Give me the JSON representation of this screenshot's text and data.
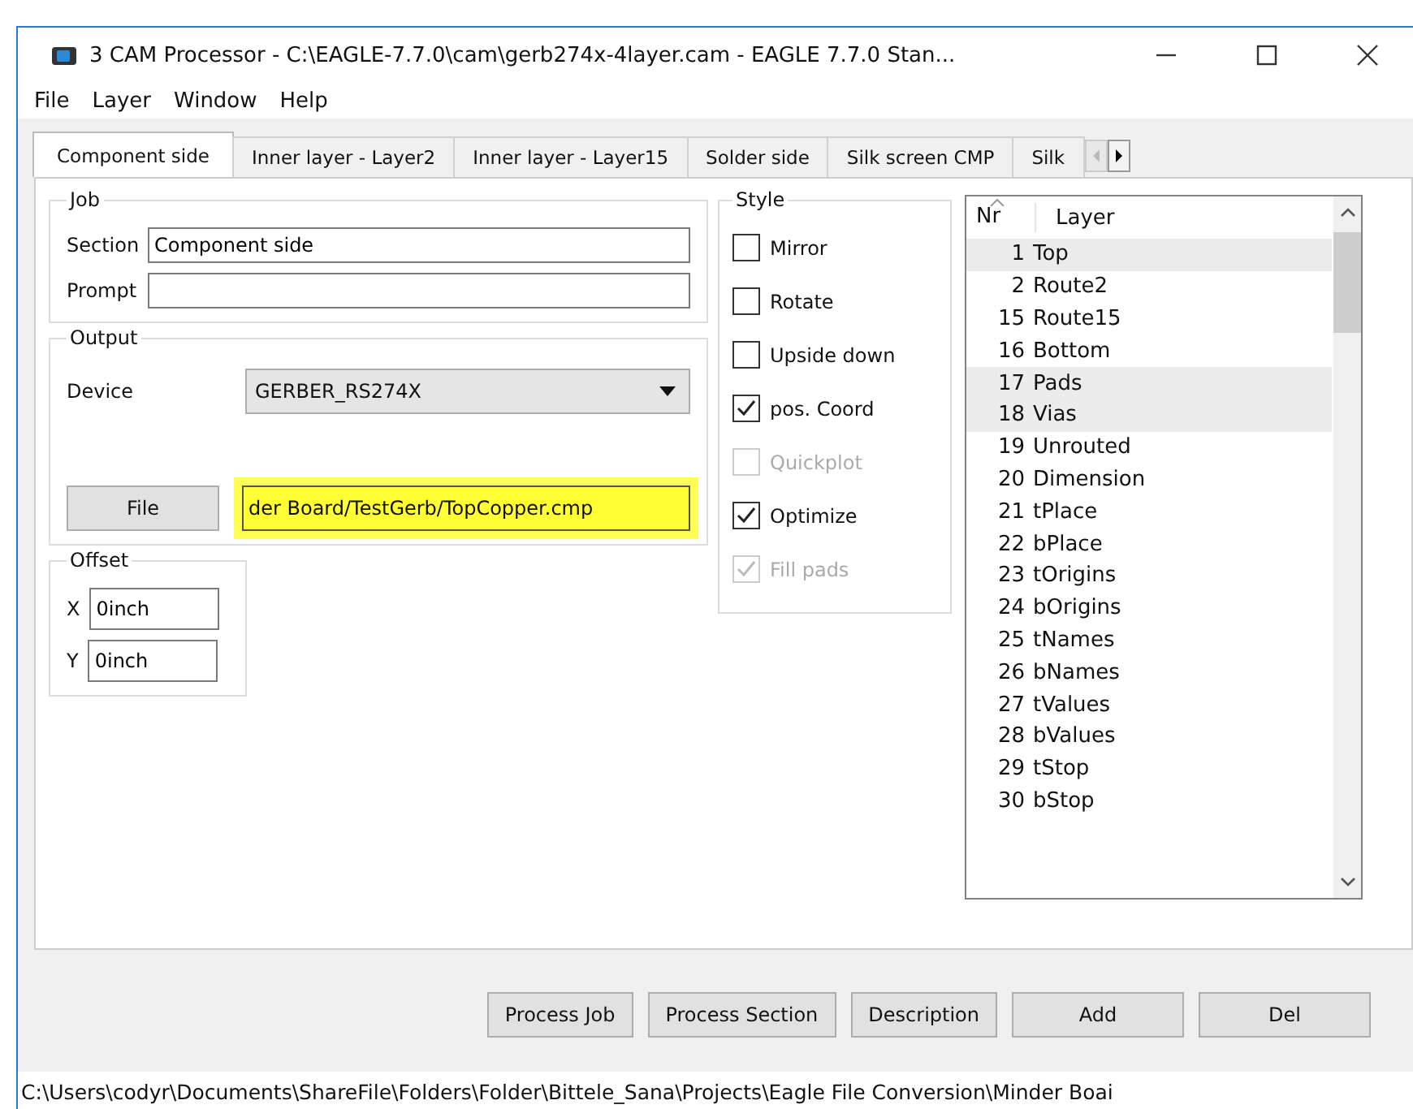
{
  "window": {
    "title": "3 CAM Processor - C:\\EAGLE-7.7.0\\cam\\gerb274x-4layer.cam - EAGLE 7.7.0 Stan..."
  },
  "menu": [
    "File",
    "Layer",
    "Window",
    "Help"
  ],
  "tabs": [
    {
      "label": "Component side",
      "selected": true
    },
    {
      "label": "Inner layer - Layer2",
      "selected": false
    },
    {
      "label": "Inner layer - Layer15",
      "selected": false
    },
    {
      "label": "Solder side",
      "selected": false
    },
    {
      "label": "Silk screen CMP",
      "selected": false
    },
    {
      "label": "Silk",
      "selected": false
    }
  ],
  "job": {
    "title": "Job",
    "section_label": "Section",
    "section_value": "Component side",
    "prompt_label": "Prompt"
  },
  "output": {
    "title": "Output",
    "device_label": "Device",
    "device_value": "GERBER_RS274X",
    "file_button": "File",
    "file_value": "der Board/TestGerb/TopCopper.cmp",
    "highlighted": true
  },
  "offset": {
    "title": "Offset",
    "x_label": "X",
    "x_value": "0inch",
    "y_label": "Y",
    "y_value": "0inch"
  },
  "style": {
    "title": "Style",
    "options": [
      {
        "label": "Mirror",
        "checked": false,
        "disabled": false
      },
      {
        "label": "Rotate",
        "checked": false,
        "disabled": false
      },
      {
        "label": "Upside down",
        "checked": false,
        "disabled": false
      },
      {
        "label": "pos. Coord",
        "checked": true,
        "disabled": false
      },
      {
        "label": "Quickplot",
        "checked": false,
        "disabled": true
      },
      {
        "label": "Optimize",
        "checked": true,
        "disabled": false
      },
      {
        "label": "Fill pads",
        "checked": true,
        "disabled": true
      }
    ]
  },
  "layers": {
    "columns": [
      "Nr",
      "Layer"
    ],
    "rows": [
      {
        "nr": "1",
        "name": "Top",
        "selected": true
      },
      {
        "nr": "2",
        "name": "Route2",
        "selected": false
      },
      {
        "nr": "15",
        "name": "Route15",
        "selected": false
      },
      {
        "nr": "16",
        "name": "Bottom",
        "selected": false
      },
      {
        "nr": "17",
        "name": "Pads",
        "selected": true
      },
      {
        "nr": "18",
        "name": "Vias",
        "selected": true
      },
      {
        "nr": "19",
        "name": "Unrouted",
        "selected": false
      },
      {
        "nr": "20",
        "name": "Dimension",
        "selected": false
      },
      {
        "nr": "21",
        "name": "tPlace",
        "selected": false
      },
      {
        "nr": "22",
        "name": "bPlace",
        "selected": false
      },
      {
        "nr": "23",
        "name": "tOrigins",
        "selected": false
      },
      {
        "nr": "24",
        "name": "bOrigins",
        "selected": false
      },
      {
        "nr": "25",
        "name": "tNames",
        "selected": false
      },
      {
        "nr": "26",
        "name": "bNames",
        "selected": false
      },
      {
        "nr": "27",
        "name": "tValues",
        "selected": false
      },
      {
        "nr": "28",
        "name": "bValues",
        "selected": false
      },
      {
        "nr": "29",
        "name": "tStop",
        "selected": false
      },
      {
        "nr": "30",
        "name": "bStop",
        "selected": false
      }
    ]
  },
  "buttons": [
    "Process Job",
    "Process Section",
    "Description",
    "Add",
    "Del"
  ],
  "status_bar": "C:\\Users\\codyr\\Documents\\ShareFile\\Folders\\Folder\\Bittele_Sana\\Projects\\Eagle File Conversion\\Minder Boai"
}
